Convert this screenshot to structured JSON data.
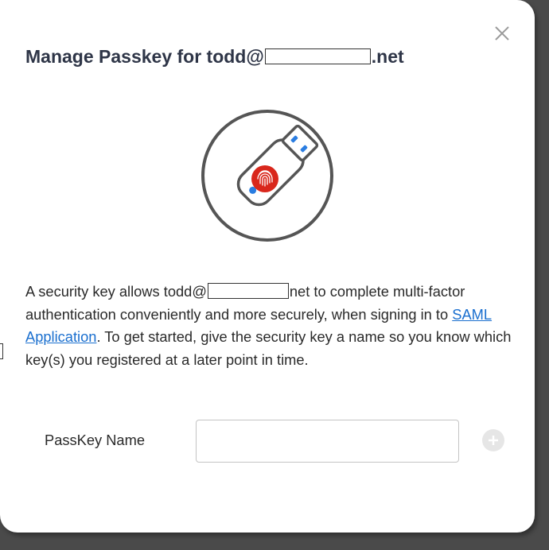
{
  "dialog": {
    "title_prefix": "Manage Passkey for todd@",
    "title_suffix": ".net",
    "close_icon": "close-icon",
    "hero_icon": "usb-security-key-icon",
    "description": {
      "part1": "A security key allows todd@",
      "part2": "net to complete multi-factor authentication conveniently and more securely, when signing in to ",
      "link": "SAML Application",
      "part3": ". To get started, give the security key a name so you know which key(s) you registered at a later point in time."
    },
    "field": {
      "label": "PassKey Name",
      "value": "",
      "placeholder": ""
    },
    "add_icon": "plus-circle-icon"
  },
  "colors": {
    "title": "#2e3547",
    "link": "#1a6fcf",
    "fingerprint": "#d9271c",
    "led": "#2a7de1",
    "outline": "#555555"
  }
}
